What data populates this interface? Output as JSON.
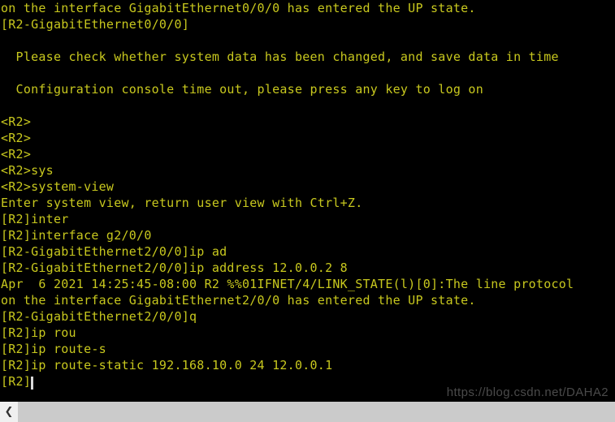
{
  "terminal": {
    "background_color": "#000000",
    "text_color": "#c8c81e",
    "lines": [
      "on the interface GigabitEthernet0/0/0 has entered the UP state.",
      "[R2-GigabitEthernet0/0/0]",
      "",
      "  Please check whether system data has been changed, and save data in time",
      "",
      "  Configuration console time out, please press any key to log on",
      "",
      "<R2>",
      "<R2>",
      "<R2>",
      "<R2>sys",
      "<R2>system-view",
      "Enter system view, return user view with Ctrl+Z.",
      "[R2]inter",
      "[R2]interface g2/0/0",
      "[R2-GigabitEthernet2/0/0]ip ad",
      "[R2-GigabitEthernet2/0/0]ip address 12.0.0.2 8",
      "Apr  6 2021 14:25:45-08:00 R2 %%01IFNET/4/LINK_STATE(l)[0]:The line protocol",
      "on the interface GigabitEthernet2/0/0 has entered the UP state.",
      "[R2-GigabitEthernet2/0/0]q",
      "[R2]ip rou",
      "[R2]ip route-s",
      "[R2]ip route-static 192.168.10.0 24 12.0.0.1",
      "[R2]"
    ]
  },
  "watermark": {
    "text": "https://blog.csdn.net/DAHA2"
  },
  "scrollbar": {
    "left_arrow_glyph": "❮"
  }
}
